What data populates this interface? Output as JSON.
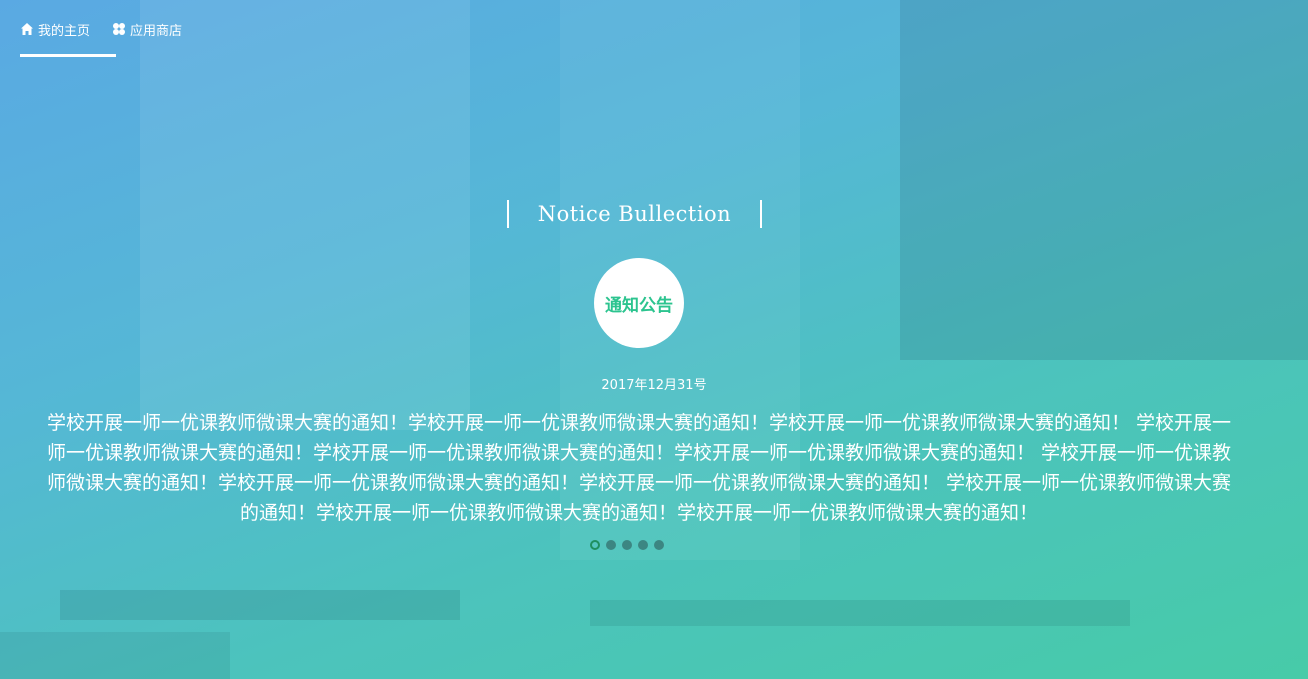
{
  "nav": {
    "items": [
      {
        "label": "我的主页",
        "icon": "home-icon",
        "active": true
      },
      {
        "label": "应用商店",
        "icon": "app-store-icon",
        "active": false
      }
    ]
  },
  "notice": {
    "heading": "Notice Bullection",
    "badge": "通知公告",
    "date": "2017年12月31号",
    "text": "学校开展一师一优课教师微课大赛的通知！学校开展一师一优课教师微课大赛的通知！学校开展一师一优课教师微课大赛的通知！ 学校开展一师一优课教师微课大赛的通知！学校开展一师一优课教师微课大赛的通知！学校开展一师一优课教师微课大赛的通知！ 学校开展一师一优课教师微课大赛的通知！学校开展一师一优课教师微课大赛的通知！学校开展一师一优课教师微课大赛的通知！ 学校开展一师一优课教师微课大赛的通知！学校开展一师一优课教师微课大赛的通知！学校开展一师一优课教师微课大赛的通知！"
  },
  "carousel": {
    "slide_count": 5,
    "active_index": 0
  },
  "colors": {
    "badge_text": "#2cc48f",
    "active_dot": "#1f8f5f"
  }
}
